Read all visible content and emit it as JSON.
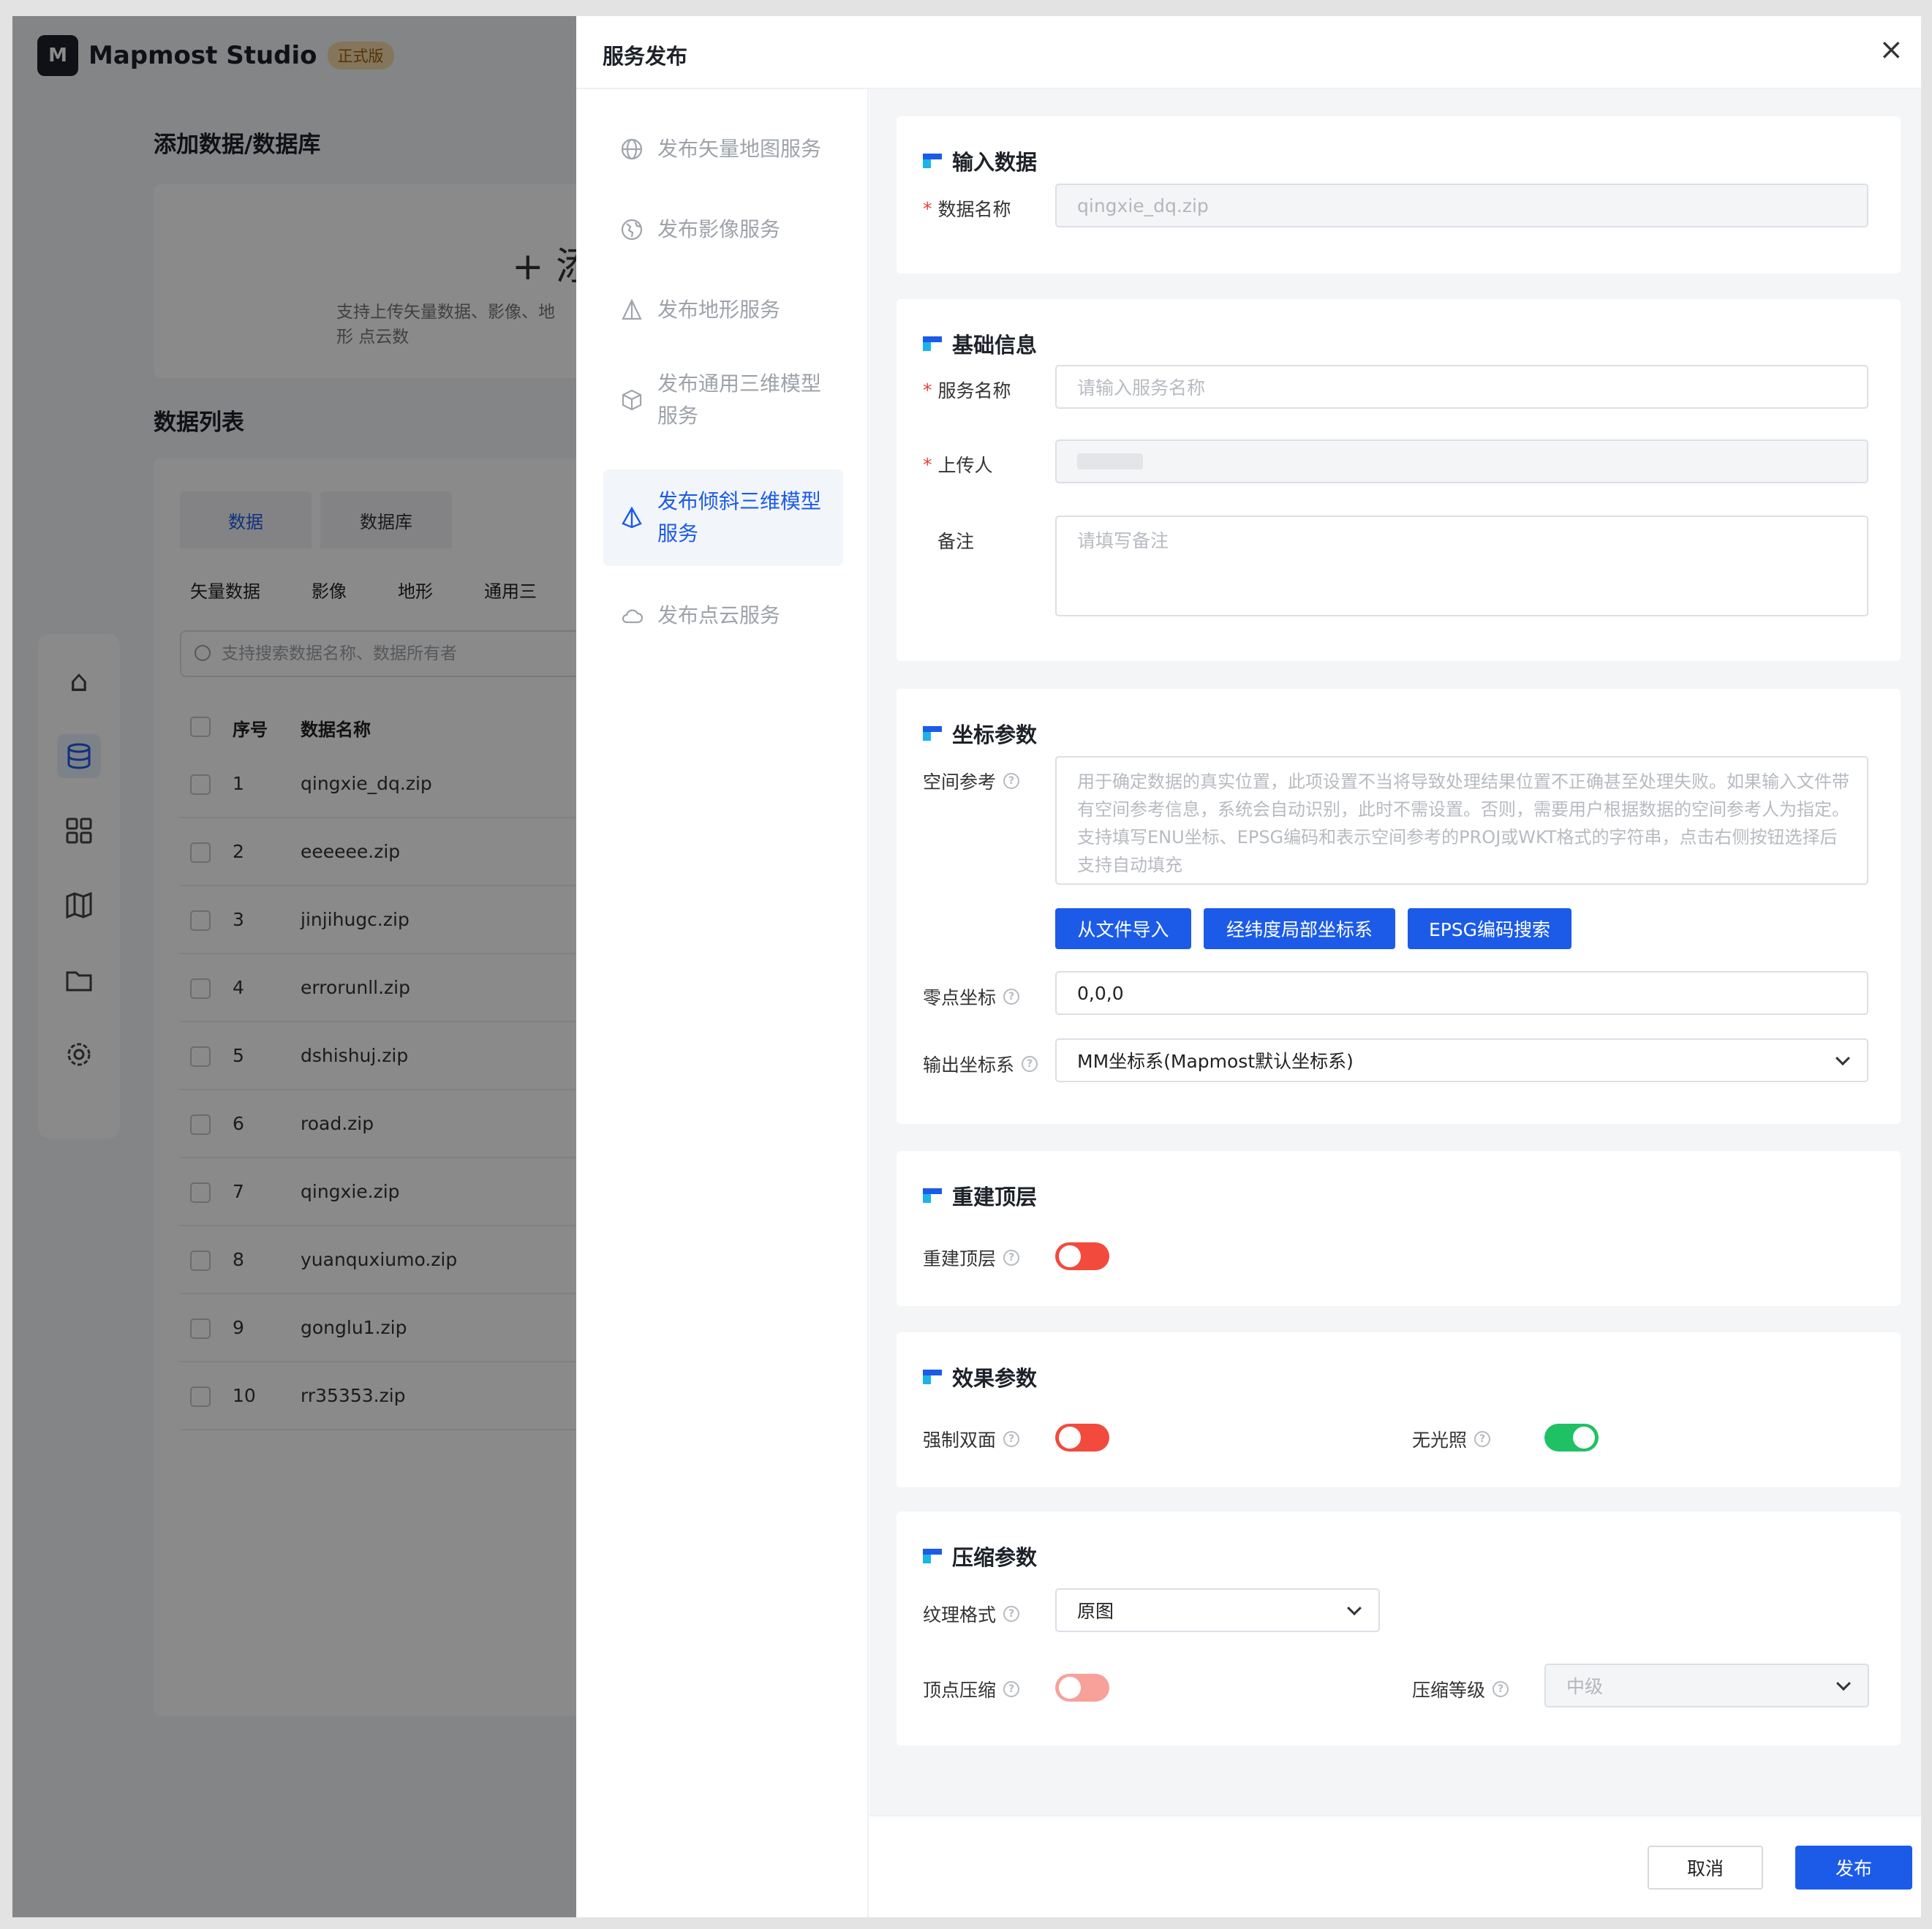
{
  "app": {
    "logo_text": "Mapmost Studio",
    "logo_mark": "M",
    "badge": "正式版",
    "add_heading": "添加数据/数据库",
    "upload_plus": "+ 添",
    "upload_hint": "支持上传矢量数据、影像、地形 点云数",
    "list_heading": "数据列表",
    "tabs": [
      "数据",
      "数据库"
    ],
    "categories": [
      "矢量数据",
      "影像",
      "地形",
      "通用三"
    ],
    "search_placeholder": "支持搜索数据名称、数据所有者",
    "columns": [
      "序号",
      "数据名称"
    ],
    "rows": [
      {
        "no": "1",
        "name": "qingxie_dq.zip"
      },
      {
        "no": "2",
        "name": "eeeeee.zip"
      },
      {
        "no": "3",
        "name": "jinjihugc.zip"
      },
      {
        "no": "4",
        "name": "errorunll.zip"
      },
      {
        "no": "5",
        "name": "dshishuj.zip"
      },
      {
        "no": "6",
        "name": "road.zip"
      },
      {
        "no": "7",
        "name": "qingxie.zip"
      },
      {
        "no": "8",
        "name": "yuanquxiumo.zip"
      },
      {
        "no": "9",
        "name": "gonglu1.zip"
      },
      {
        "no": "10",
        "name": "rr35353.zip"
      }
    ],
    "nav_icons": [
      "home-icon",
      "database-icon",
      "apps-icon",
      "map-icon",
      "folder-icon",
      "settings-icon"
    ]
  },
  "drawer": {
    "title": "服务发布",
    "close_glyph": "×",
    "menu": [
      {
        "label": "发布矢量地图服务",
        "icon": "globe-icon"
      },
      {
        "label": "发布影像服务",
        "icon": "earth-icon"
      },
      {
        "label": "发布地形服务",
        "icon": "terrain-icon"
      },
      {
        "label": "发布通用三维模型服务",
        "icon": "cube-icon"
      },
      {
        "label": "发布倾斜三维模型服务",
        "icon": "pyramid-icon",
        "active": true
      },
      {
        "label": "发布点云服务",
        "icon": "cloud-icon"
      }
    ],
    "sections": {
      "input": {
        "title": "输入数据",
        "data_name_label": "数据名称",
        "data_name_value": "qingxie_dq.zip"
      },
      "basic": {
        "title": "基础信息",
        "service_name_label": "服务名称",
        "service_name_placeholder": "请输入服务名称",
        "uploader_label": "上传人",
        "remark_label": "备注",
        "remark_placeholder": "请填写备注"
      },
      "coord": {
        "title": "坐标参数",
        "spatial_label": "空间参考",
        "spatial_placeholder": "用于确定数据的真实位置，此项设置不当将导致处理结果位置不正确甚至处理失败。如果输入文件带有空间参考信息，系统会自动识别，此时不需设置。否则，需要用户根据数据的空间参考人为指定。支持填写ENU坐标、EPSG编码和表示空间参考的PROJ或WKT格式的字符串，点击右侧按钮选择后支持自动填充",
        "btn_import": "从文件导入",
        "btn_latlon": "经纬度局部坐标系",
        "btn_epsg": "EPSG编码搜索",
        "origin_label": "零点坐标",
        "origin_value": "0,0,0",
        "output_label": "输出坐标系",
        "output_value": "MM坐标系(Mapmost默认坐标系)"
      },
      "rebuild": {
        "title": "重建顶层",
        "label": "重建顶层",
        "on": false
      },
      "effect": {
        "title": "效果参数",
        "double_label": "强制双面",
        "double_on": false,
        "nolight_label": "无光照",
        "nolight_on": true
      },
      "compress": {
        "title": "压缩参数",
        "texture_label": "纹理格式",
        "texture_value": "原图",
        "vertex_label": "顶点压缩",
        "vertex_on": false,
        "level_label": "压缩等级",
        "level_value": "中级"
      }
    },
    "footer": {
      "cancel": "取消",
      "publish": "发布"
    }
  },
  "colors": {
    "accent": "#1c5be8",
    "toggle_off": "#f24a3d",
    "toggle_on": "#1ec264"
  }
}
